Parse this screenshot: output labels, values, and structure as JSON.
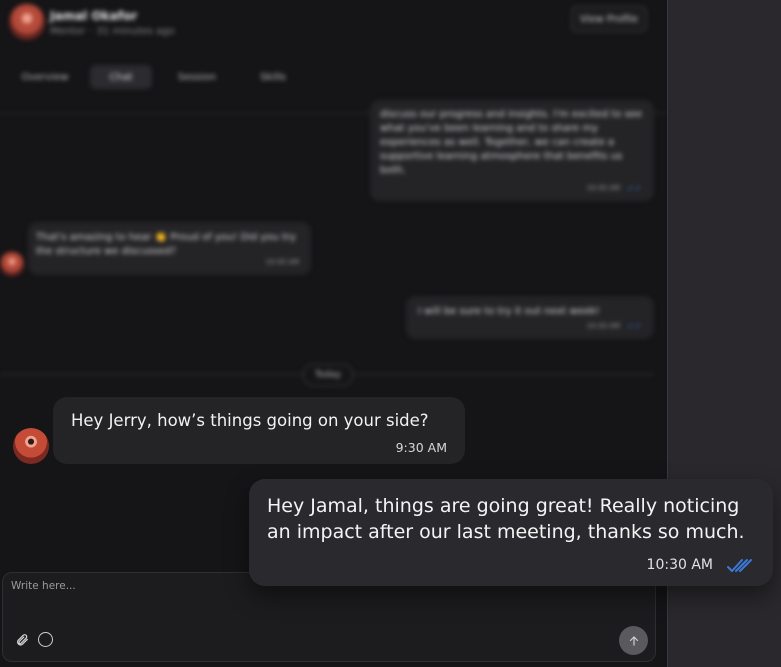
{
  "contact": {
    "name": "Jamal Okafor",
    "role": "Mentor",
    "last_seen": "31 minutes ago",
    "view_profile_label": "View Profile"
  },
  "tabs": [
    {
      "label": "Overview",
      "active": false
    },
    {
      "label": "Chat",
      "active": true
    },
    {
      "label": "Session",
      "active": false
    },
    {
      "label": "Skills",
      "active": false
    }
  ],
  "history": [
    {
      "direction": "out",
      "text": "discuss our progress and insights. I'm excited to see what you've been learning and to share my experiences as well. Together, we can create a supportive learning atmosphere that benefits us both.",
      "time": "10:30 AM"
    },
    {
      "direction": "in",
      "text": "That's amazing to hear 👏 Proud of you! Did you try the structure we discussed?",
      "time": "10:30 AM"
    },
    {
      "direction": "out",
      "text": "I will be sure to try it out next week!",
      "time": "10:30 AM"
    }
  ],
  "divider_label": "Today",
  "incoming": {
    "text": "Hey Jerry, how’s things going on your side?",
    "time": "9:30 AM"
  },
  "outgoing": {
    "text": "Hey Jamal, things are going great! Really noticing an impact after our last meeting, thanks so much.",
    "time": "10:30 AM",
    "read": true
  },
  "composer": {
    "placeholder": "Write here..."
  },
  "icons": {
    "attach": "paperclip-icon",
    "emoji": "emoji-icon",
    "send": "arrow-up-icon",
    "read_receipt": "double-check-icon"
  },
  "colors": {
    "read_check": "#3b7ad8",
    "bubble_in": "#242326",
    "bubble_out": "#2a292d",
    "panel_bg": "#151416"
  }
}
